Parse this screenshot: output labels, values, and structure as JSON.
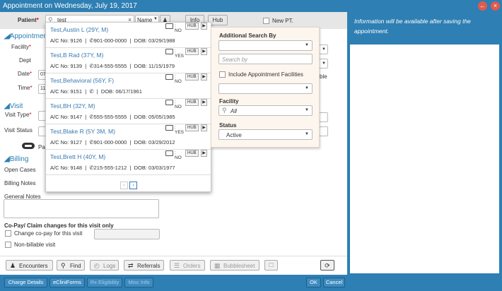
{
  "window": {
    "title": "Appointment on Wednesday, July 19, 2017",
    "back_icon": "arrow-left-icon",
    "close_icon": "close-icon"
  },
  "form": {
    "patient_label": "Patient",
    "search_value": "test",
    "search_type": "Name",
    "info_button": "Info",
    "hub_button": "Hub",
    "new_pt_label": "New PT.",
    "appointment_section": "Appointment",
    "facility_label": "Facility",
    "dept_label": "Dept",
    "date_label": "Date",
    "date_value_partial": "07",
    "time_label": "Time",
    "time_value_partial": "11",
    "ble_partial": "ble",
    "visit_section": "Visit",
    "visit_type_label": "Visit Type",
    "visit_status_label": "Visit Status",
    "pay_partial": "Pa",
    "billing_section": "Billing",
    "open_cases_label": "Open Cases",
    "billing_notes_label": "Billing Notes",
    "general_notes_label": "General Notes",
    "copay_heading": "Co-Pay/ Claim changes for this visit only",
    "change_copay_label": "Change co-pay for this visit",
    "non_billable_label": "Non-billable visit"
  },
  "patients": [
    {
      "name": "Test,Austin L (29Y, M)",
      "portal": ": NO",
      "hub": "HUB",
      "acct": "A/C No: 9126",
      "phone": "901-000-0000",
      "dob": "DOB: 03/29/1988"
    },
    {
      "name": "Test,B Rad (37Y, M)",
      "portal": ": YES",
      "hub": "HUB",
      "acct": "A/C No: 9139",
      "phone": "314-555-5555",
      "dob": "DOB: 11/15/1979"
    },
    {
      "name": "Test,Behavioral (56Y, F)",
      "portal": ": NO",
      "hub": "HUB",
      "acct": "A/C No: 9151",
      "phone": "",
      "dob": "DOB: 06/17/1961"
    },
    {
      "name": "Test,BH (32Y, M)",
      "portal": ": NO",
      "hub": "HUB",
      "acct": "A/C No: 9147",
      "phone": "555-555-5555",
      "dob": "DOB: 05/05/1985"
    },
    {
      "name": "Test,Blake R (5Y 3M, M)",
      "portal": ": YES",
      "hub": "HUB",
      "acct": "A/C No: 9127",
      "phone": "901-000-0000",
      "dob": "DOB: 03/29/2012"
    },
    {
      "name": "Test,Brett H (40Y, M)",
      "portal": ": NO",
      "hub": "HUB",
      "acct": "A/C No: 9148",
      "phone": "215-555-1212",
      "dob": "DOB: 03/03/1977"
    }
  ],
  "advanced": {
    "additional_search_by": "Additional Search By",
    "search_placeholder": "Search by",
    "include_facilities": "Include Appointment Facilities",
    "facility_label": "Facility",
    "facility_value": "All",
    "status_label": "Status",
    "status_value": "Active"
  },
  "right_panel": {
    "message": "Information will be available after saving the appointment."
  },
  "toolbar": {
    "encounters": "Encounters",
    "find": "Find",
    "logs": "Logs",
    "referrals": "Referrals",
    "orders": "Orders",
    "bubblesheet": "Bubblesheet"
  },
  "bottom": {
    "charge_details": "Charge Details",
    "ecliniforms": "eCliniForms",
    "rx_eligibility": "Rx Eligibility",
    "misc_info": "Misc Info",
    "ok": "OK",
    "cancel": "Cancel"
  },
  "colors": {
    "brand_blue": "#2e7fb3",
    "link_blue": "#3a78b0",
    "close_red": "#e05a4f"
  }
}
